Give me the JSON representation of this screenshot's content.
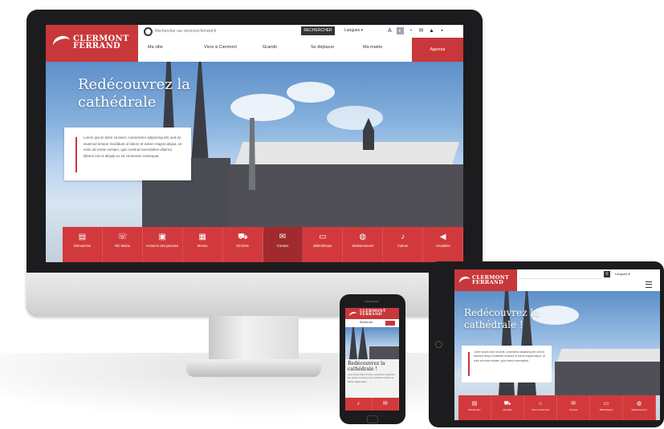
{
  "brand": {
    "name": "CLERMONT\nFERRAND",
    "accent_color": "#c8373a",
    "dark_accent_color": "#a02a2d"
  },
  "desktop": {
    "search": {
      "placeholder": "Rechercher sur clermont-ferrand.fr",
      "button_label": "RECHERCHER"
    },
    "language": "Langues ▾",
    "utility_icons": [
      "text-size-icon",
      "contrast-icon",
      "rss-icon",
      "mail-icon",
      "user-icon",
      "print-icon"
    ],
    "nav": {
      "items": [
        "Ma ville",
        "Vivre à Clermont",
        "Grandir",
        "Se déplacer",
        "Ma mairie"
      ],
      "cta": "Agenda"
    },
    "hero": {
      "title": "Redécouvrez la cathédrale",
      "card_text": "Lorem ipsum dolor sit amet, consectetur adipiscing elit, sed do eiusmod tempor incididunt ut labore et dolore magna aliqua. Ut enim ad minim veniam, quis nostrud exercitation ullamco laboris nisi ut aliquip ex ea commodo consequat."
    },
    "quick_links": [
      {
        "label": "Démarches",
        "icon": "form-icon"
      },
      {
        "label": "Allo Mairie",
        "icon": "phone-icon"
      },
      {
        "label": "Horaires des piscines",
        "icon": "bus-icon"
      },
      {
        "label": "Menus",
        "icon": "menu-icon"
      },
      {
        "label": "Déchets",
        "icon": "truck-icon"
      },
      {
        "label": "Contact",
        "icon": "chat-icon"
      },
      {
        "label": "Bibliothèque",
        "icon": "keyboard-icon"
      },
      {
        "label": "Stationnement",
        "icon": "globe-icon"
      },
      {
        "label": "Culture",
        "icon": "culture-icon"
      },
      {
        "label": "Actualités",
        "icon": "megaphone-icon"
      }
    ]
  },
  "tablet": {
    "language": "Langues ▾",
    "hero_title": "Redécouvrez la cathédrale !",
    "card_text": "Lorem ipsum dolor sit amet, consectetur adipiscing elit, sed do eiusmod tempor incididunt ut labore et dolore magna aliqua. Ut enim ad minim veniam, quis nostrud exercitation.",
    "quick_links": [
      "Démarches",
      "Déchets",
      "Vivre à Clermont",
      "Contact",
      "Bibliothèque",
      "Stationnement"
    ]
  },
  "phone": {
    "search_label": "Rechercher",
    "hero_title": "Redécouvrez la cathédrale !",
    "text": "Lorem ipsum dolor sit amet, consectetur adipiscing elit, sed do eiusmod tempor incididunt ut labore et dolore magna aliqua."
  }
}
